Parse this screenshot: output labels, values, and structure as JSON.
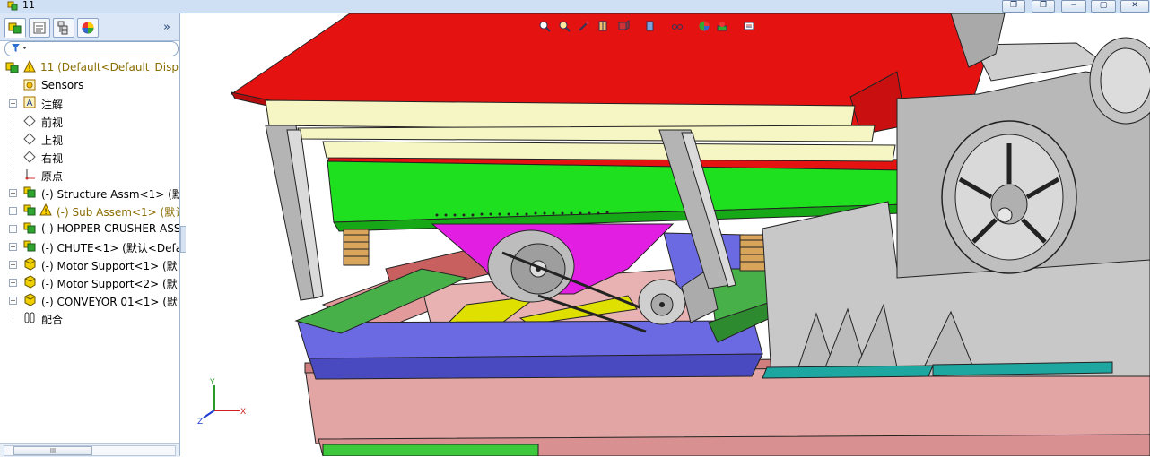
{
  "window": {
    "title": "11",
    "buttons": [
      "restore-small",
      "restore",
      "minimize",
      "restore-down",
      "close"
    ]
  },
  "panel_tabs": [
    "feature-manager",
    "property-manager",
    "configuration-manager",
    "display-manager"
  ],
  "tree": {
    "root": "11  (Default<Default_Displ",
    "items": [
      {
        "label": "Sensors",
        "icon": "sensor-icon",
        "expandable": false
      },
      {
        "label": "注解",
        "icon": "annotation-icon",
        "expandable": true
      },
      {
        "label": "前视",
        "icon": "plane-icon",
        "expandable": false
      },
      {
        "label": "上视",
        "icon": "plane-icon",
        "expandable": false
      },
      {
        "label": "右视",
        "icon": "plane-icon",
        "expandable": false
      },
      {
        "label": "原点",
        "icon": "origin-icon",
        "expandable": false
      },
      {
        "label": "(-) Structure Assm<1> (默",
        "icon": "assembly-icon",
        "expandable": true
      },
      {
        "label": "(-) Sub Assem<1> (默认",
        "icon": "assembly-warning-icon",
        "expandable": true,
        "warning": true
      },
      {
        "label": "(-) HOPPER CRUSHER ASS",
        "icon": "assembly-icon",
        "expandable": true
      },
      {
        "label": "(-) CHUTE<1> (默认<Defa",
        "icon": "assembly-icon",
        "expandable": true
      },
      {
        "label": "(-) Motor Support<1> (默",
        "icon": "part-icon",
        "expandable": true
      },
      {
        "label": "(-) Motor Support<2> (默",
        "icon": "part-icon",
        "expandable": true
      },
      {
        "label": "(-) CONVEYOR 01<1> (默i",
        "icon": "part-icon",
        "expandable": true
      },
      {
        "label": "配合",
        "icon": "mates-icon",
        "expandable": false
      }
    ]
  },
  "hud_toolbar": [
    "zoom-to-fit-icon",
    "zoom-area-icon",
    "previous-view-icon",
    "section-view-icon",
    "view-orientation-icon",
    "display-style-icon",
    "hide-show-icon",
    "edit-appearance-icon",
    "apply-scene-icon",
    "view-settings-icon"
  ],
  "triad": {
    "x": "X",
    "y": "Y",
    "z": "Z"
  },
  "colors": {
    "hopper": "#e31414",
    "vibrator_frame": "#19e019",
    "motor_mount": "#e31ee3",
    "base_plate": "#6a6ae6",
    "support_beam": "#e0a0a0",
    "crusher_body": "#c8c8c8",
    "cross_beams": "#f5f5c8"
  }
}
